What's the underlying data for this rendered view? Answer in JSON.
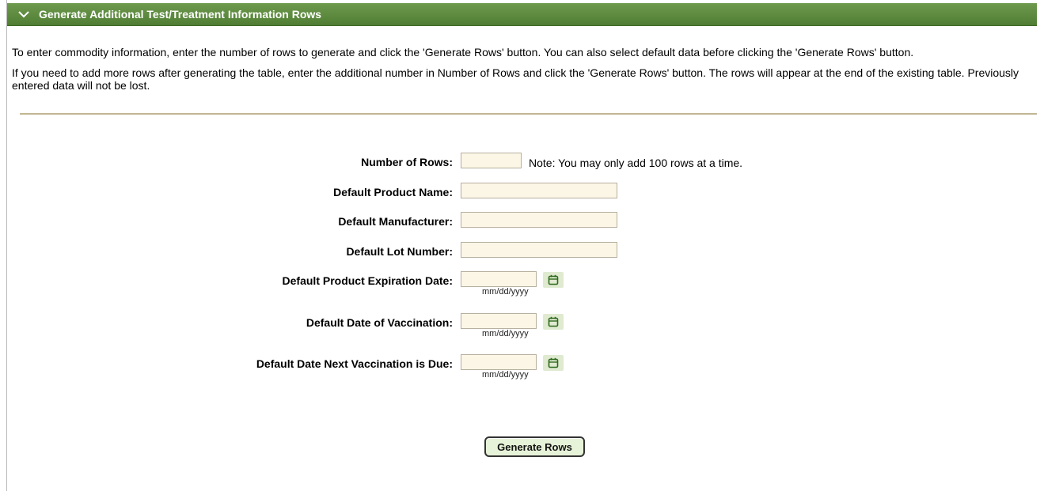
{
  "section": {
    "title": "Generate Additional Test/Treatment Information Rows",
    "icon": "chevron-down-icon"
  },
  "intro": {
    "line1": "To enter commodity information, enter the number of rows to generate and click the 'Generate Rows' button. You can also select default data before clicking the 'Generate Rows' button.",
    "line2": "If you need to add more rows after generating the table, enter the additional number in Number of Rows and click the 'Generate Rows' button. The rows will appear at the end of the existing table. Previously entered data will not be lost."
  },
  "form": {
    "num_rows": {
      "label": "Number of Rows:",
      "value": "",
      "note": "Note: You may only add 100 rows at a time."
    },
    "product_name": {
      "label": "Default Product Name:",
      "value": ""
    },
    "manufacturer": {
      "label": "Default Manufacturer:",
      "value": ""
    },
    "lot_number": {
      "label": "Default Lot Number:",
      "value": ""
    },
    "expiration_date": {
      "label": "Default Product Expiration Date:",
      "value": "",
      "hint": "mm/dd/yyyy",
      "icon": "calendar-icon"
    },
    "vaccination_date": {
      "label": "Default Date of Vaccination:",
      "value": "",
      "hint": "mm/dd/yyyy",
      "icon": "calendar-icon"
    },
    "next_due_date": {
      "label": "Default Date Next Vaccination is Due:",
      "value": "",
      "hint": "mm/dd/yyyy",
      "icon": "calendar-icon"
    }
  },
  "actions": {
    "generate_label": "Generate Rows"
  },
  "colors": {
    "header_bg": "#5a8a3c",
    "input_bg": "#fbf6e6",
    "calendar_bg": "#dfead0",
    "button_bg": "#e7f3d8",
    "divider": "#c2b694"
  }
}
